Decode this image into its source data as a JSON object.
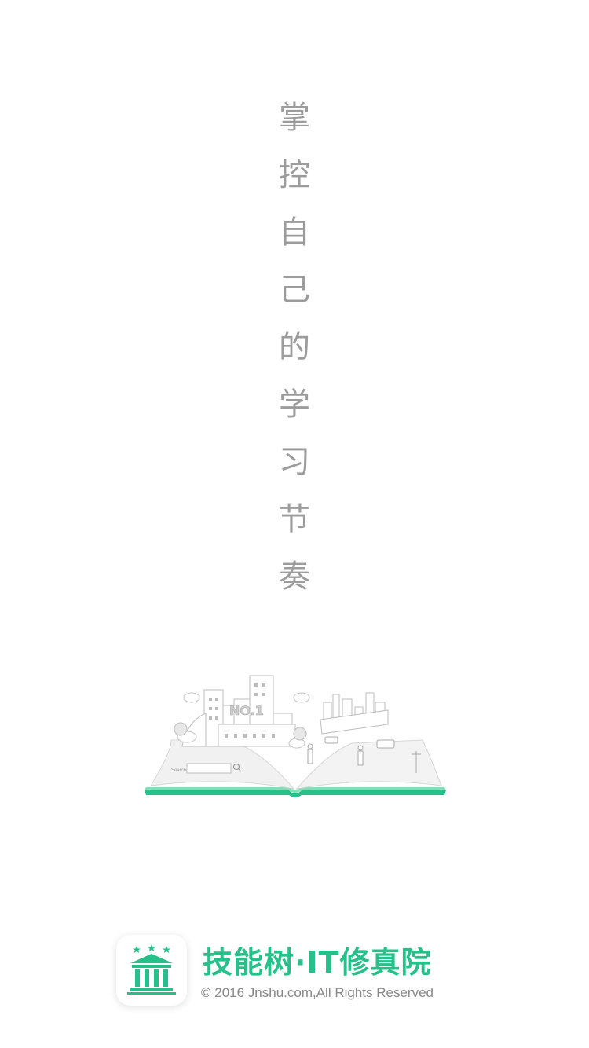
{
  "slogan": {
    "chars": [
      "掌",
      "控",
      "自",
      "己",
      "的",
      "学",
      "习",
      "节",
      "奏"
    ]
  },
  "illustration": {
    "search_label": "Search",
    "badge_text": "NO.1"
  },
  "footer": {
    "app_name": "技能树·IT修真院",
    "copyright": "© 2016 Jnshu.com,All Rights Reserved"
  },
  "colors": {
    "brand": "#27c08a",
    "slogan_text": "#9c9c9c",
    "copyright_text": "#888888"
  },
  "icons": [
    "temple-logo-icon",
    "open-book-city-illustration",
    "search-icon"
  ]
}
